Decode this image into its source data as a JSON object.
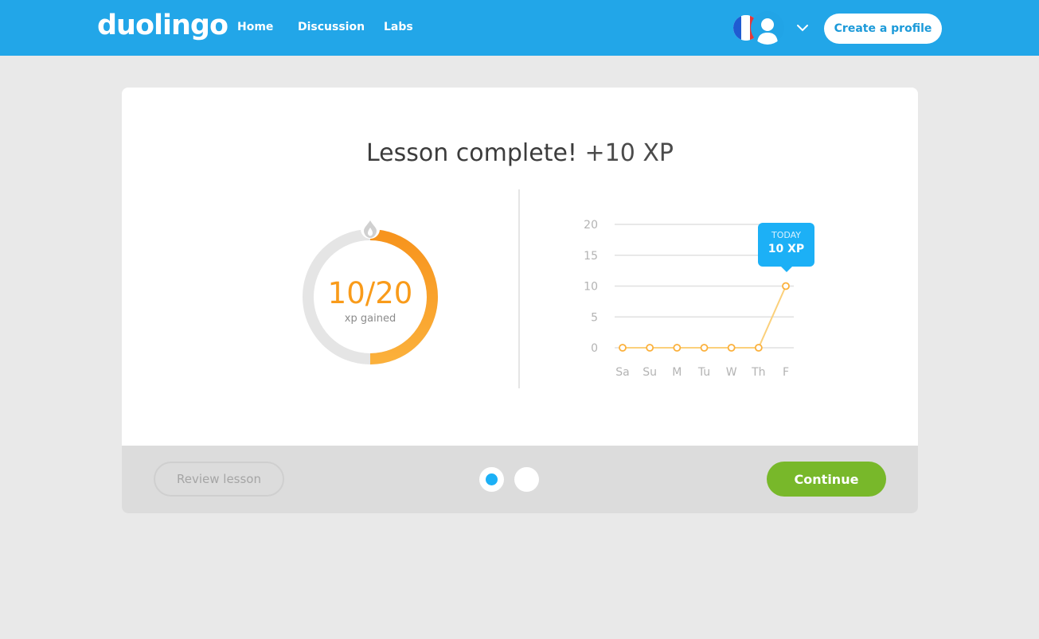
{
  "header": {
    "logo": "duolingo",
    "nav": [
      "Home",
      "Discussion",
      "Labs"
    ],
    "language_flag": "flag-france-icon",
    "avatar_icon": "user-avatar-icon",
    "dropdown_icon": "chevron-down-icon",
    "create_profile_label": "Create a profile"
  },
  "lesson": {
    "title": "Lesson complete!",
    "xp_gained_title": "+10 XP",
    "progress_value": "10/20",
    "progress_caption": "xp gained",
    "progress_fraction": 0.5,
    "goal_icon": "flame-icon"
  },
  "tooltip": {
    "label": "TODAY",
    "value": "10 XP"
  },
  "chart_data": {
    "type": "line",
    "categories": [
      "Sa",
      "Su",
      "M",
      "Tu",
      "W",
      "Th",
      "F"
    ],
    "values": [
      0,
      0,
      0,
      0,
      0,
      0,
      10
    ],
    "y_ticks": [
      0,
      5,
      10,
      15,
      20
    ],
    "ylim": [
      0,
      20
    ],
    "grid": true,
    "title": "",
    "xlabel": "",
    "ylabel": ""
  },
  "footer": {
    "review_label": "Review lesson",
    "continue_label": "Continue",
    "pager": {
      "count": 2,
      "active": 0
    }
  },
  "colors": {
    "header_bg": "#22a6e8",
    "accent_orange": "#f99b1a",
    "ring_track": "#e5e5e5",
    "chart_line": "#fbd07b",
    "tooltip_bg": "#1cb0f6",
    "continue_bg": "#78b82a"
  }
}
